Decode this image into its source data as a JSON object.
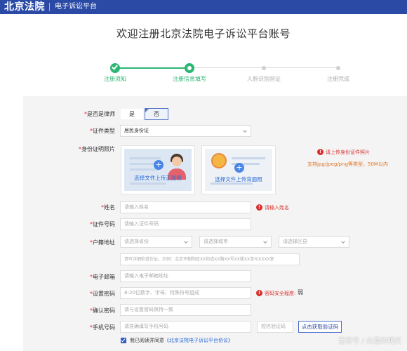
{
  "header": {
    "brand": "北京法院",
    "platform": "电子诉讼平台",
    "bg_color": "#2b4aa6"
  },
  "page_title": "欢迎注册北京法院电子诉讼平台账号",
  "steps": [
    {
      "label": "注册须知",
      "state": "done"
    },
    {
      "label": "注册信息填写",
      "state": "current"
    },
    {
      "label": "人脸识别验证",
      "state": "todo"
    },
    {
      "label": "注册完成",
      "state": "todo"
    }
  ],
  "form": {
    "lawyer": {
      "label": "是否是律师",
      "yes": "是",
      "no": "否",
      "selected": "否"
    },
    "id_type": {
      "label": "证件类型",
      "value": "居民身份证"
    },
    "id_photo": {
      "label": "身份证明照片",
      "front_text": "选择文件上传正面照",
      "back_text": "选择文件上传背面照",
      "warn": "请上传身份证件照片",
      "hint": "支持jpg/jpeg/png等类型，50M以内"
    },
    "name": {
      "label": "姓名",
      "placeholder": "请输入姓名",
      "error": "请输入姓名"
    },
    "id_number": {
      "label": "证件号码",
      "placeholder": "请输入证件号码"
    },
    "household": {
      "label": "户籍地址",
      "province": "请选择省份",
      "city": "请选择城市",
      "district": "请选择区县",
      "detail_placeholder": "请写详细街道住址。示例：北京市朝阳区XX街道XX路XX号XX楼XX单元XXXX室"
    },
    "email": {
      "label": "电子邮箱",
      "placeholder": "请输入电子邮箱地址"
    },
    "password": {
      "label": "设置密码",
      "placeholder": "8-20位数字、字母、特殊符号组成",
      "strength_label": "密码安全程度:",
      "strength_value": "弱"
    },
    "confirm_password": {
      "label": "确认密码",
      "placeholder": "请与设置密码保持一致"
    },
    "phone": {
      "label": "手机号码",
      "placeholder": "请准确填写手机号码",
      "code_placeholder": "短信验证码",
      "code_button": "点击获取验证码"
    },
    "agreement": {
      "checked": true,
      "text": "我已阅读并同意",
      "link": "《北京法院电子诉讼平台协议》"
    }
  },
  "watermark": "百家号 / 众嘉的明天",
  "colors": {
    "success": "#2bb673",
    "error": "#d9302c",
    "link": "#2b6cd6"
  }
}
